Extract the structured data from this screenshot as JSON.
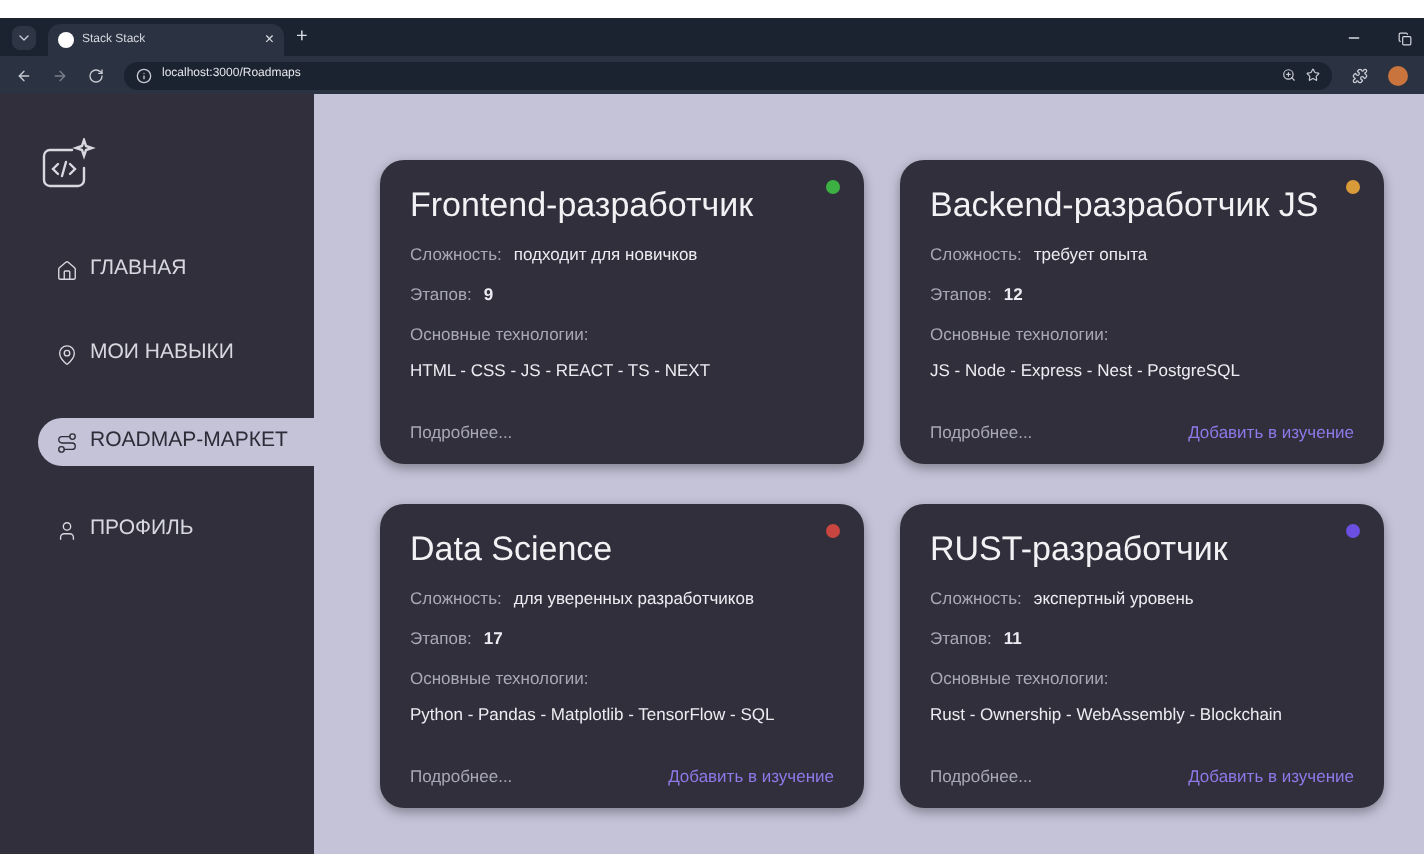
{
  "browser": {
    "tab_title": "Stack Stack",
    "close": "×",
    "new_tab": "+",
    "url": "localhost:3000/Roadmaps"
  },
  "sidebar": {
    "items": [
      {
        "label": "ГЛАВНАЯ",
        "kind": "home",
        "selected": false
      },
      {
        "label": "МОИ НАВЫКИ",
        "kind": "pin",
        "selected": false
      },
      {
        "label": "ROADMAP-МАРКЕТ",
        "kind": "route",
        "selected": true
      },
      {
        "label": "ПРОФИЛЬ",
        "kind": "user",
        "selected": false
      }
    ]
  },
  "cards": [
    {
      "title": "Frontend-разработчик",
      "color": "#3cb043",
      "difficulty_label": "Сложность:",
      "difficulty": "подходит для новичков",
      "stages_label": "Этапов:",
      "stages": "9",
      "tech_label": "Основные технологии:",
      "tech": "HTML - CSS - JS - REACT - TS - NEXT",
      "more": "Подробнее..."
    },
    {
      "title": "Backend-разработчик JS",
      "color": "#d99a3a",
      "difficulty_label": "Сложность:",
      "difficulty": "требует опыта",
      "stages_label": "Этапов:",
      "stages": "12",
      "tech_label": "Основные технологии:",
      "tech": "JS - Node - Express - Nest - PostgreSQL",
      "more": "Подробнее...",
      "add": "Добавить в изучение"
    },
    {
      "title": "Data Science",
      "color": "#c8463f",
      "difficulty_label": "Сложность:",
      "difficulty": "для уверенных разработчиков",
      "stages_label": "Этапов:",
      "stages": "17",
      "tech_label": "Основные технологии:",
      "tech": "Python - Pandas - Matplotlib - TensorFlow - SQL",
      "more": "Подробнее...",
      "add": "Добавить в изучение"
    },
    {
      "title": "RUST-разработчик",
      "color": "#6b4fe0",
      "difficulty_label": "Сложность:",
      "difficulty": "экспертный уровень",
      "stages_label": "Этапов:",
      "stages": "11",
      "tech_label": "Основные технологии:",
      "tech": "Rust - Ownership - WebAssembly - Blockchain",
      "more": "Подробнее...",
      "add": "Добавить в изучение"
    }
  ]
}
